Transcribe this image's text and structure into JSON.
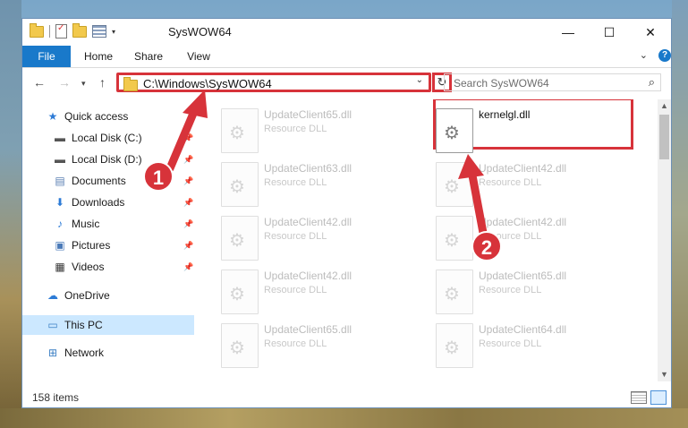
{
  "window": {
    "title": "SysWOW64"
  },
  "window_controls": {
    "minimize": "—",
    "maximize": "☐",
    "close": "✕"
  },
  "ribbon": {
    "tabs": [
      "File",
      "Home",
      "Share",
      "View"
    ],
    "help": "?"
  },
  "address_bar": {
    "path": "C:\\Windows\\SysWOW64"
  },
  "search": {
    "placeholder": "Search SysWOW64"
  },
  "nav_pane": {
    "items": [
      {
        "label": "Quick access",
        "icon": "star-icon"
      },
      {
        "label": "Local Disk (C:)",
        "icon": "drive-icon",
        "pinned": true
      },
      {
        "label": "Local Disk (D:)",
        "icon": "drive-icon",
        "pinned": true
      },
      {
        "label": "Documents",
        "icon": "documents-icon",
        "pinned": true
      },
      {
        "label": "Downloads",
        "icon": "downloads-icon",
        "pinned": true
      },
      {
        "label": "Music",
        "icon": "music-icon",
        "pinned": true
      },
      {
        "label": "Pictures",
        "icon": "pictures-icon",
        "pinned": true
      },
      {
        "label": "Videos",
        "icon": "videos-icon",
        "pinned": true
      },
      {
        "label": "OneDrive",
        "icon": "cloud-icon"
      },
      {
        "label": "This PC",
        "icon": "computer-icon",
        "selected": true
      },
      {
        "label": "Network",
        "icon": "network-icon"
      }
    ]
  },
  "files": [
    {
      "name": "UpdateClient65.dll",
      "type": "Resource DLL"
    },
    {
      "name": "kernelgl.dll",
      "type": ""
    },
    {
      "name": "UpdateClient63.dll",
      "type": "Resource DLL"
    },
    {
      "name": "UpdateClient42.dll",
      "type": "Resource DLL"
    },
    {
      "name": "UpdateClient42.dll",
      "type": "Resource DLL"
    },
    {
      "name": "UpdateClient42.dll",
      "type": "Resource DLL"
    },
    {
      "name": "UpdateClient42.dll",
      "type": "Resource DLL"
    },
    {
      "name": "UpdateClient65.dll",
      "type": "Resource DLL"
    },
    {
      "name": "UpdateClient65.dll",
      "type": "Resource DLL"
    },
    {
      "name": "UpdateClient64.dll",
      "type": "Resource DLL"
    }
  ],
  "status": {
    "item_count": "158 items"
  },
  "annotations": {
    "step1": "1",
    "step2": "2",
    "color": "#d7333a"
  }
}
